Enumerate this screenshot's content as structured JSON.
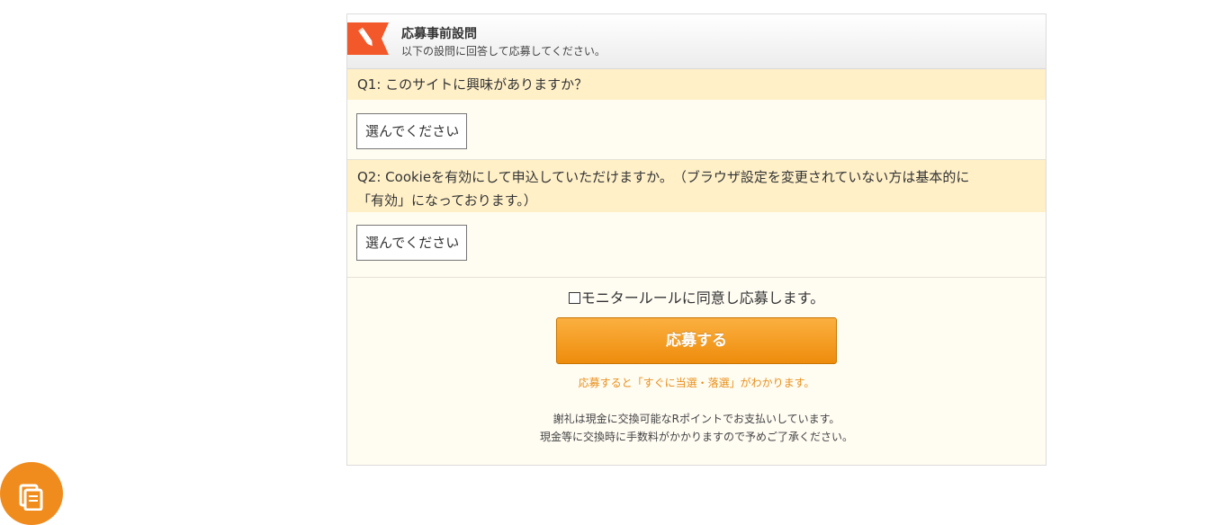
{
  "header": {
    "icon": "pencil-icon",
    "title": "応募事前設問",
    "subtitle": "以下の設問に回答して応募してください。"
  },
  "questions": [
    {
      "label": "Q1: このサイトに興味がありますか？",
      "select_value": "選んでください"
    },
    {
      "label_line1": "Q2: Cookieを有効にして申込していただけますか。　（ブラウザ設定を変更されていない方は基本的に",
      "label_line2": "「有効」になっております。）",
      "select_value": "選んでください"
    }
  ],
  "agree": {
    "checked": false,
    "label": "モニタールールに同意し応募します。"
  },
  "submit": {
    "label": "応募する",
    "note": "応募すると「すぐに当選・落選」がわかります。"
  },
  "notice": {
    "line1": "謝礼は現金に交換可能なRポイントでお支払いしています。",
    "line2": "現金等に交換時に手数料がかかりますので予めご了承ください。"
  },
  "floating_button": {
    "icon": "document-icon"
  },
  "colors": {
    "accent_orange": "#ee8c0c",
    "question_bg": "#fff0c8",
    "panel_bg": "#fffcf2",
    "badge_red": "#f2582a"
  }
}
